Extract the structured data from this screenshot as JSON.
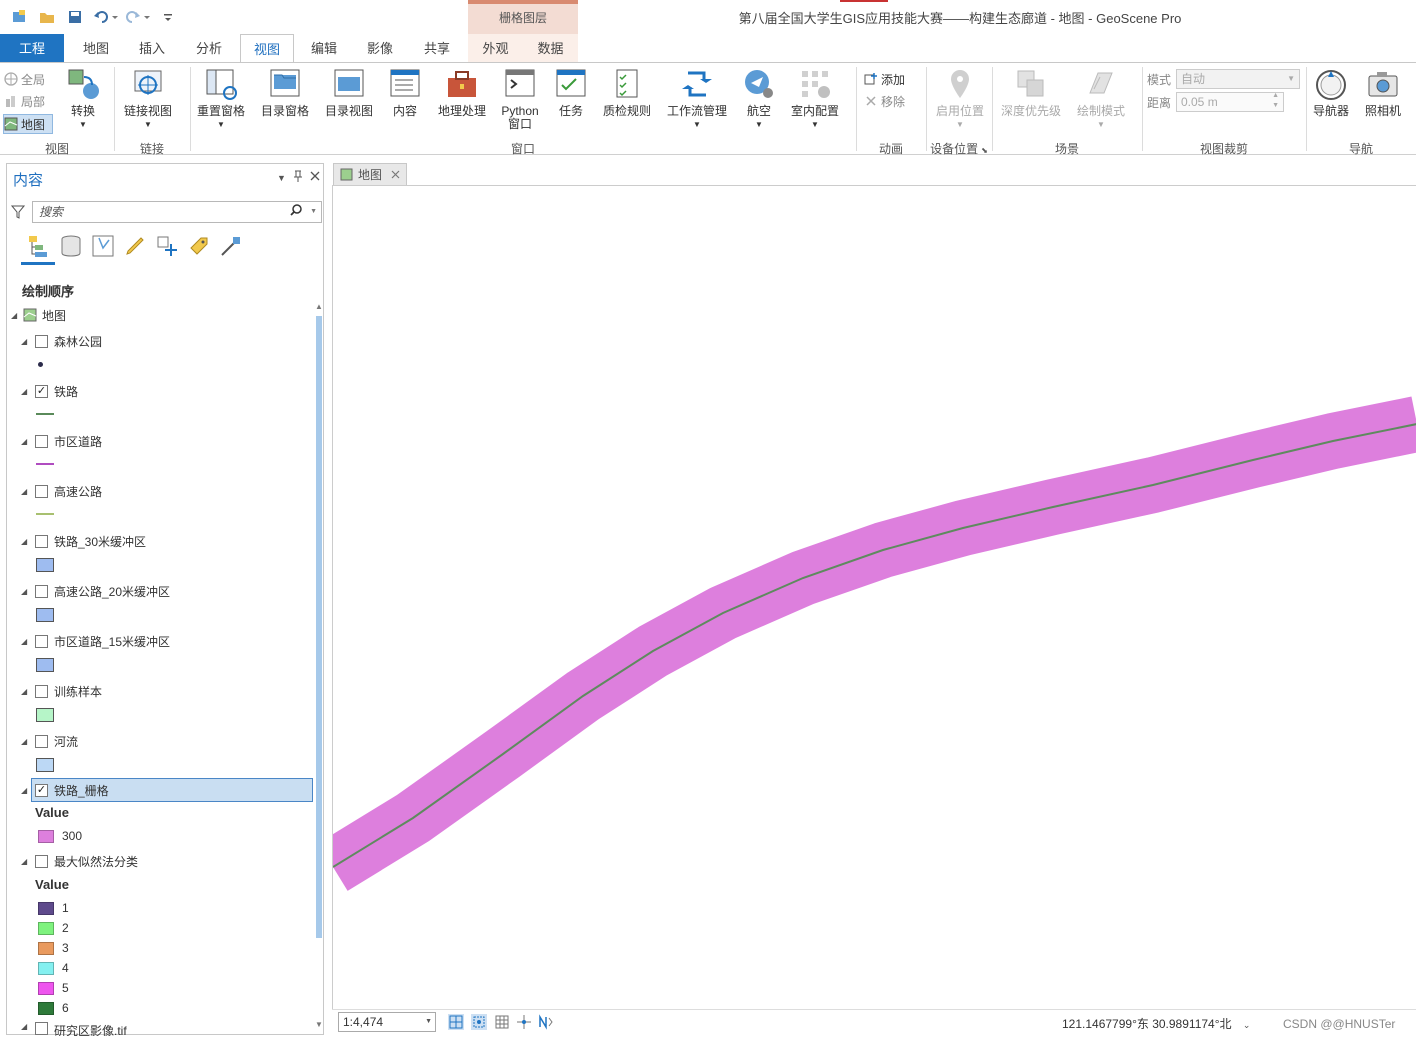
{
  "app": {
    "window_title": "第八届全国大学生GIS应用技能大赛——构建生态廊道 - 地图 - GeoScene Pro",
    "context_tab_header": "栅格图层"
  },
  "tabs": [
    {
      "label": "工程"
    },
    {
      "label": "地图"
    },
    {
      "label": "插入"
    },
    {
      "label": "分析"
    },
    {
      "label": "视图"
    },
    {
      "label": "编辑"
    },
    {
      "label": "影像"
    },
    {
      "label": "共享"
    },
    {
      "label": "外观"
    },
    {
      "label": "数据"
    }
  ],
  "ribbon": {
    "view_group": {
      "full": "全局",
      "local": "局部",
      "map": "地图",
      "convert": "转换",
      "label": "视图"
    },
    "link_group": {
      "link_views": "链接视图",
      "label": "链接"
    },
    "window_group": {
      "reset_panes": "重置窗格",
      "catalog_pane": "目录窗格",
      "catalog_view": "目录视图",
      "contents": "内容",
      "geoprocessing": "地理处理",
      "python_line1": "Python",
      "python_line2": "窗口",
      "tasks": "任务",
      "qa_rules": "质检规则",
      "workflow_mgr": "工作流管理",
      "aviation": "航空",
      "indoor_config": "室内配置",
      "label": "窗口"
    },
    "animation_group": {
      "add": "添加",
      "remove": "移除",
      "label": "动画"
    },
    "device_group": {
      "enable_location": "启用位置",
      "label": "设备位置"
    },
    "scene_group": {
      "depth_priority": "深度优先级",
      "draw_mode": "绘制模式",
      "label": "场景"
    },
    "clip_group": {
      "mode_label": "模式",
      "mode_value": "自动",
      "distance_label": "距离",
      "distance_value": "0.05  m",
      "label": "视图裁剪"
    },
    "nav_group": {
      "navigator": "导航器",
      "camera": "照相机",
      "label": "导航"
    }
  },
  "contents_pane": {
    "title": "内容",
    "search_placeholder": "搜索",
    "draw_order": "绘制顺序",
    "map_name": "地图",
    "layers": [
      {
        "name": "森林公园",
        "checked": false,
        "symbol": "point",
        "color": "#2b2b4a"
      },
      {
        "name": "铁路",
        "checked": true,
        "symbol": "line",
        "color": "#5a8a5a"
      },
      {
        "name": "市区道路",
        "checked": false,
        "symbol": "line",
        "color": "#b04cc0"
      },
      {
        "name": "高速公路",
        "checked": false,
        "symbol": "line",
        "color": "#a8c070"
      },
      {
        "name": "铁路_30米缓冲区",
        "checked": false,
        "symbol": "fill",
        "color": "#9ebcf0"
      },
      {
        "name": "高速公路_20米缓冲区",
        "checked": false,
        "symbol": "fill",
        "color": "#9ebcf0"
      },
      {
        "name": "市区道路_15米缓冲区",
        "checked": false,
        "symbol": "fill",
        "color": "#9ebcf0"
      },
      {
        "name": "训练样本",
        "checked": false,
        "symbol": "fill",
        "color": "#b6f5c8"
      },
      {
        "name": "河流",
        "checked": false,
        "symbol": "fill",
        "color": "#bcd8f5"
      }
    ],
    "raster_layer": {
      "name": "铁路_栅格",
      "checked": true,
      "value_header": "Value",
      "classes": [
        {
          "label": "300",
          "color": "#dd7fdd"
        }
      ]
    },
    "classified_layer": {
      "name": "最大似然法分类",
      "checked": false,
      "value_header": "Value",
      "classes": [
        {
          "label": "1",
          "color": "#5e4a8c"
        },
        {
          "label": "2",
          "color": "#7ef27e"
        },
        {
          "label": "3",
          "color": "#e99a5e"
        },
        {
          "label": "4",
          "color": "#84f0f0"
        },
        {
          "label": "5",
          "color": "#ee55ee"
        },
        {
          "label": "6",
          "color": "#2e7a3a"
        }
      ]
    },
    "truncated_layer": "研究区影像.tif"
  },
  "map_view": {
    "tab_label": "地图",
    "buffer_color": "#dd7fdd",
    "rail_color": "#5e8a5e"
  },
  "status_bar": {
    "scale": "1:4,474",
    "coordinates": "121.1467799°东 30.9891174°北",
    "watermark": "CSDN @@HNUSTer"
  }
}
